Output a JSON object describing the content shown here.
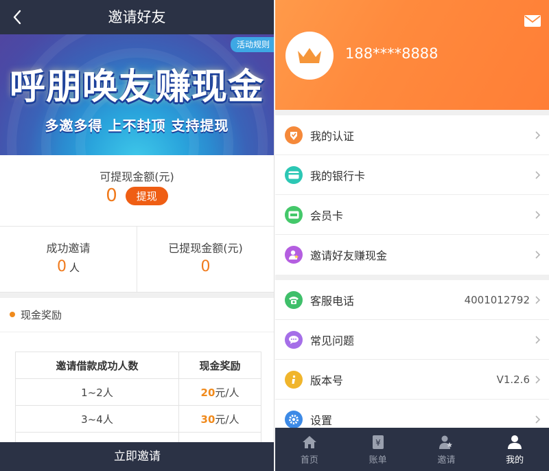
{
  "invite_page": {
    "header": {
      "title": "邀请好友"
    },
    "banner": {
      "rules_label": "活动规则",
      "slogan": "呼朋唤友赚现金",
      "subline": "多邀多得  上不封顶  支持提现"
    },
    "withdrawable": {
      "label": "可提现金额(元)",
      "amount": "0",
      "button": "提现"
    },
    "stats": {
      "invited_label": "成功邀请",
      "invited_value": "0",
      "invited_unit": "人",
      "withdrawn_label": "已提现金额(元)",
      "withdrawn_value": "0"
    },
    "section_title": "现金奖励",
    "table": {
      "headers": [
        "邀请借款成功人数",
        "现金奖励"
      ],
      "rows": [
        {
          "count": "1~2人",
          "reward_num": "20",
          "reward_unit": "元/人"
        },
        {
          "count": "3~4人",
          "reward_num": "30",
          "reward_unit": "元/人"
        }
      ]
    },
    "invite_button": "立即邀请"
  },
  "profile_page": {
    "phone": "188****8888",
    "menu_group1": [
      {
        "label": "我的认证",
        "icon": "verify-icon",
        "color": "#f5893a"
      },
      {
        "label": "我的银行卡",
        "icon": "bank-card-icon",
        "color": "#2cc7b4"
      },
      {
        "label": "会员卡",
        "icon": "vip-card-icon",
        "color": "#44c86a"
      },
      {
        "label": "邀请好友赚现金",
        "icon": "invite-icon",
        "color": "#b45ee0"
      }
    ],
    "menu_group2": [
      {
        "label": "客服电话",
        "icon": "phone-icon",
        "color": "#3fbf6a",
        "value": "4001012792"
      },
      {
        "label": "常见问题",
        "icon": "faq-icon",
        "color": "#a56fe8",
        "value": ""
      },
      {
        "label": "版本号",
        "icon": "info-icon",
        "color": "#f0b52c",
        "value": "V1.2.6"
      },
      {
        "label": "设置",
        "icon": "settings-icon",
        "color": "#3d8ae6",
        "value": ""
      }
    ],
    "tabs": [
      {
        "label": "首页",
        "icon": "home-icon"
      },
      {
        "label": "账单",
        "icon": "bill-icon"
      },
      {
        "label": "邀请",
        "icon": "invite-tab-icon"
      },
      {
        "label": "我的",
        "icon": "user-icon"
      }
    ],
    "active_tab": "我的"
  }
}
